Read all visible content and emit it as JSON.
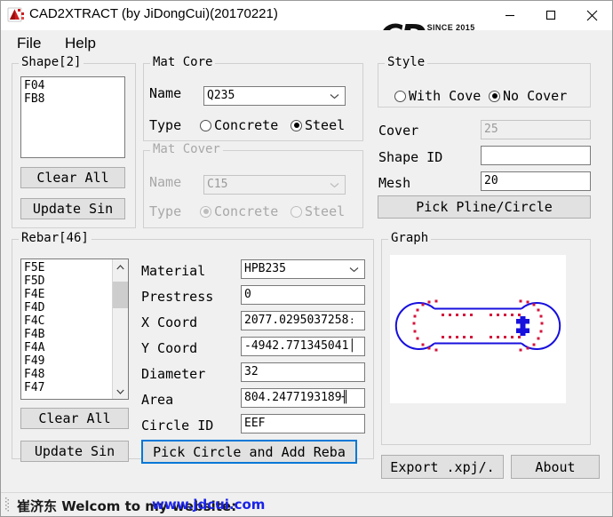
{
  "window": {
    "title": "CAD2XTRACT (by JiDongCui)(20170221)",
    "icon": "cad-app-icon",
    "minimize_label": "–",
    "maximize_label": "□",
    "close_label": "✕"
  },
  "brand": {
    "mark": "CD",
    "since": "SINCE 2015",
    "url": "www.jdcui.com"
  },
  "menu": {
    "items": [
      {
        "label": "File"
      },
      {
        "label": "Help"
      }
    ]
  },
  "shape_group": {
    "legend": "Shape[2]",
    "list_items": [
      "F04",
      "FB8"
    ],
    "clear_all_label": "Clear All",
    "update_label": "Update Sin"
  },
  "mat_core": {
    "legend": "Mat Core",
    "name_label": "Name",
    "name_value": "Q235",
    "type_label": "Type",
    "concrete_label": "Concrete",
    "steel_label": "Steel",
    "selected_type": "Steel"
  },
  "mat_cover": {
    "legend": "Mat Cover",
    "name_label": "Name",
    "name_value": "C15",
    "type_label": "Type",
    "concrete_label": "Concrete",
    "steel_label": "Steel",
    "selected_type": "Concrete",
    "enabled": false
  },
  "style_group": {
    "legend": "Style",
    "with_cover_label": "With Cove",
    "no_cover_label": "No Cover",
    "selected": "No Cover"
  },
  "params": {
    "cover_label": "Cover",
    "cover_value": "25",
    "cover_enabled": false,
    "shape_id_label": "Shape ID",
    "shape_id_value": "",
    "mesh_label": "Mesh",
    "mesh_value": "20",
    "pick_pline_label": "Pick Pline/Circle"
  },
  "rebar_group": {
    "legend": "Rebar[46]",
    "list_items": [
      "F5E",
      "F5D",
      "F4E",
      "F4D",
      "F4C",
      "F4B",
      "F4A",
      "F49",
      "F48",
      "F47"
    ],
    "clear_all_label": "Clear All",
    "update_label": "Update Sin",
    "pick_circle_label": "Pick Circle and Add Reba",
    "fields": [
      {
        "label": "Material",
        "value": "HPB235",
        "type": "combo"
      },
      {
        "label": "Prestress",
        "value": "0",
        "type": "text"
      },
      {
        "label": "X Coord",
        "value": "2077.0295037258։",
        "type": "text"
      },
      {
        "label": "Y Coord",
        "value": "-4942.771345041│",
        "type": "text"
      },
      {
        "label": "Diameter",
        "value": "32",
        "type": "text"
      },
      {
        "label": "Area",
        "value": "804.2477193189╢",
        "type": "text"
      },
      {
        "label": "Circle ID",
        "value": "EEF",
        "type": "text"
      }
    ]
  },
  "graph_group": {
    "legend": "Graph",
    "outline_color": "#1810dd",
    "rebar_color": "#d4143c",
    "background": "#ffffff"
  },
  "actions": {
    "export_label": "Export .xpj/.",
    "about_label": "About"
  },
  "status": {
    "author": "崔济东  Welcom to my website:",
    "link": "www.jdcui.com"
  }
}
